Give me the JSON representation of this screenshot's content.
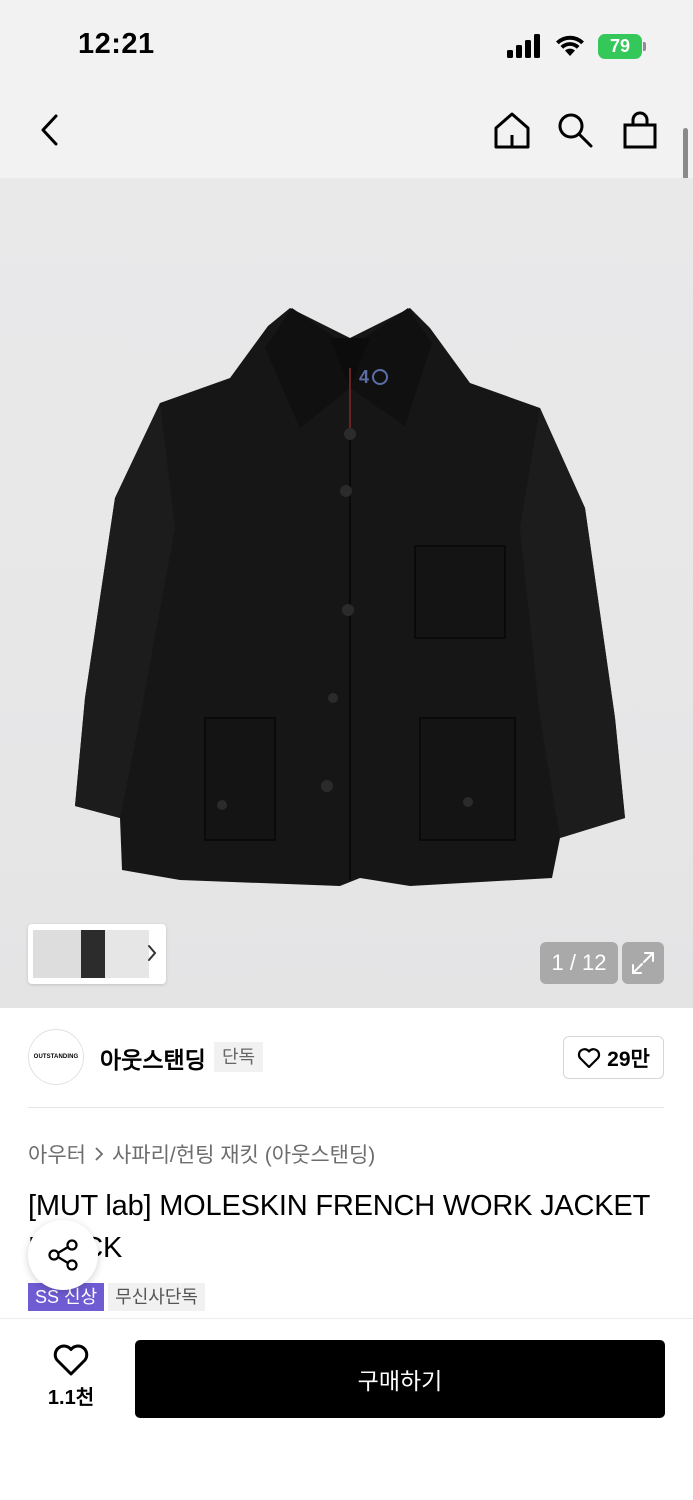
{
  "status_bar": {
    "time": "12:21",
    "battery": "79"
  },
  "top_nav": {
    "back_icon": "chevron-left-icon",
    "home_icon": "home-icon",
    "search_icon": "search-icon",
    "cart_icon": "shopping-bag-icon"
  },
  "gallery": {
    "counter": "1 / 12",
    "current": 1,
    "total": 12
  },
  "brand": {
    "logo_text": "OUTSTANDING",
    "name": "아웃스탠딩",
    "exclusive_label": "단독",
    "likes": "29만"
  },
  "breadcrumb": {
    "category": "아우터",
    "subcategory": "사파리/헌팅 재킷 (아웃스탠딩)"
  },
  "product": {
    "title": "[MUT lab] MOLESKIN FRENCH WORK JACKET BLACK",
    "tags": [
      "SS 신상",
      "무신사단독"
    ]
  },
  "bottom_bar": {
    "wish_count": "1.1천",
    "buy_label": "구매하기"
  },
  "colors": {
    "accent_tag": "#6f5bd2",
    "buy_button": "#000000",
    "battery": "#34c759"
  }
}
